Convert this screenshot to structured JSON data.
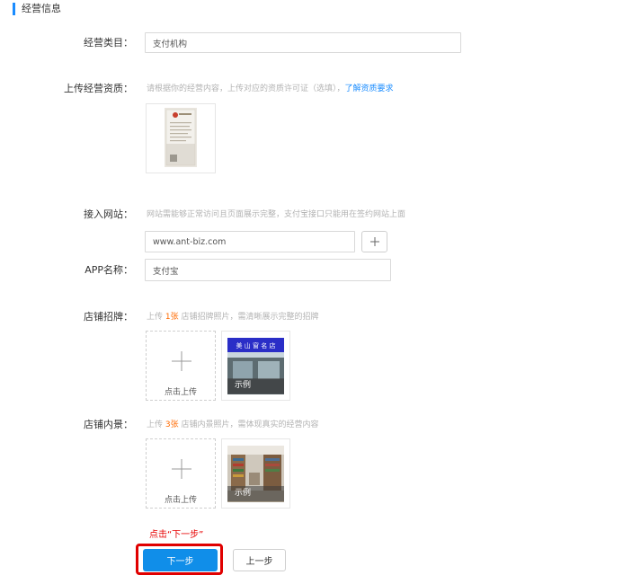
{
  "section": {
    "title": "经营信息"
  },
  "business_category": {
    "label": "经营类目：",
    "value": "支付机构"
  },
  "qualification": {
    "label": "上传经营资质：",
    "hint": "请根据你的经营内容，上传对应的资质许可证（选填），",
    "link": "了解资质要求"
  },
  "website": {
    "label": "接入网站：",
    "hint": "网站需能够正常访问且页面展示完整，支付宝接口只能用在签约网站上面",
    "value": "www.ant-biz.com",
    "add_icon": "plus-icon"
  },
  "app_name": {
    "label": "APP名称：",
    "value": "支付宝"
  },
  "shop_sign": {
    "label": "店铺招牌：",
    "hint_prefix": "上传 ",
    "hint_count": "1张",
    "hint_suffix": " 店铺招牌照片，需清晰展示完整的招牌",
    "upload_label": "点击上传",
    "sample_label": "示例",
    "sign_text": "美 山 窗 名 店"
  },
  "shop_interior": {
    "label": "店铺内景：",
    "hint_prefix": "上传 ",
    "hint_count": "3张",
    "hint_suffix": " 店铺内景照片，需体现真实的经营内容",
    "upload_label": "点击上传",
    "sample_label": "示例"
  },
  "annotation": "点击“下一步”",
  "actions": {
    "next": "下一步",
    "prev": "上一步"
  },
  "colors": {
    "accent": "#1a8cff",
    "primary_button": "#108ee9",
    "annotation": "#e60000",
    "highlight": "#ff6a00"
  }
}
